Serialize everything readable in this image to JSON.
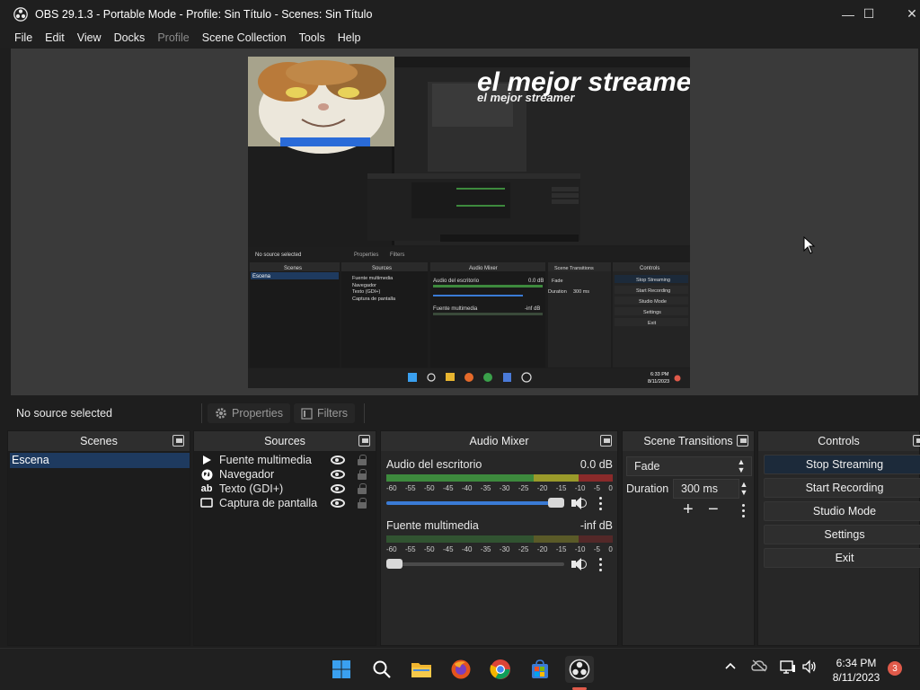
{
  "window": {
    "title": "OBS 29.1.3 - Portable Mode - Profile: Sin Título - Scenes: Sin Título",
    "minimize_label": "—",
    "maximize_label": "☐",
    "close_label": "✕"
  },
  "menu": {
    "items": [
      "File",
      "Edit",
      "View",
      "Docks",
      "Profile",
      "Scene Collection",
      "Tools",
      "Help"
    ]
  },
  "preview": {
    "overlay_text": "el mejor streamer",
    "overlay_text_small": "el mejor streamer",
    "nested_labels": {
      "no_source": "No source selected",
      "properties": "Properties",
      "filters": "Filters",
      "scenes": "Scenes",
      "sources": "Sources",
      "audio_mixer": "Audio Mixer",
      "scene_transitions": "Scene Transitions",
      "controls": "Controls",
      "scene": "Escena",
      "src1": "Fuente multimedia",
      "src2": "Navegador",
      "src3": "Texto (GDI+)",
      "src4": "Captura de pantalla",
      "mix1": "Audio del escritorio",
      "mix1_db": "0.0 dB",
      "mix2": "Fuente multimedia",
      "mix2_db": "-inf dB",
      "fade": "Fade",
      "duration": "Duration",
      "duration_val": "300 ms",
      "stop_streaming": "Stop Streaming",
      "start_recording": "Start Recording",
      "studio_mode": "Studio Mode",
      "settings": "Settings",
      "exit": "Exit",
      "time": "6:33 PM",
      "date": "8/11/2023"
    }
  },
  "source_toolbar": {
    "no_source": "No source selected",
    "properties": "Properties",
    "filters": "Filters"
  },
  "scenes_dock": {
    "title": "Scenes",
    "items": [
      "Escena"
    ]
  },
  "sources_dock": {
    "title": "Sources",
    "items": [
      {
        "label": "Fuente multimedia",
        "icon": "play-icon"
      },
      {
        "label": "Navegador",
        "icon": "globe-icon"
      },
      {
        "label": "Texto (GDI+)",
        "icon": "text-icon"
      },
      {
        "label": "Captura de pantalla",
        "icon": "monitor-icon"
      }
    ]
  },
  "audio_mixer": {
    "title": "Audio Mixer",
    "ticks": [
      "-60",
      "-55",
      "-50",
      "-45",
      "-40",
      "-35",
      "-30",
      "-25",
      "-20",
      "-15",
      "-10",
      "-5",
      "0"
    ],
    "channels": [
      {
        "name": "Audio del escritorio",
        "level": "0.0 dB",
        "volume_fraction": 1.0
      },
      {
        "name": "Fuente multimedia",
        "level": "-inf dB",
        "volume_fraction": 0.0
      }
    ]
  },
  "transitions": {
    "title": "Scene Transitions",
    "selected": "Fade",
    "duration_label": "Duration",
    "duration_value": "300 ms"
  },
  "controls": {
    "title": "Controls",
    "buttons": [
      "Stop Streaming",
      "Start Recording",
      "Studio Mode",
      "Settings",
      "Exit"
    ]
  },
  "taskbar": {
    "time": "6:34 PM",
    "date": "8/11/2023",
    "notification_count": "3"
  },
  "colors": {
    "accent": "#3a7bd5",
    "selection": "#1e3a5f",
    "meter_green": "#3d8a3d",
    "meter_yellow": "#9a9a2a",
    "meter_red": "#8a2a2a"
  }
}
